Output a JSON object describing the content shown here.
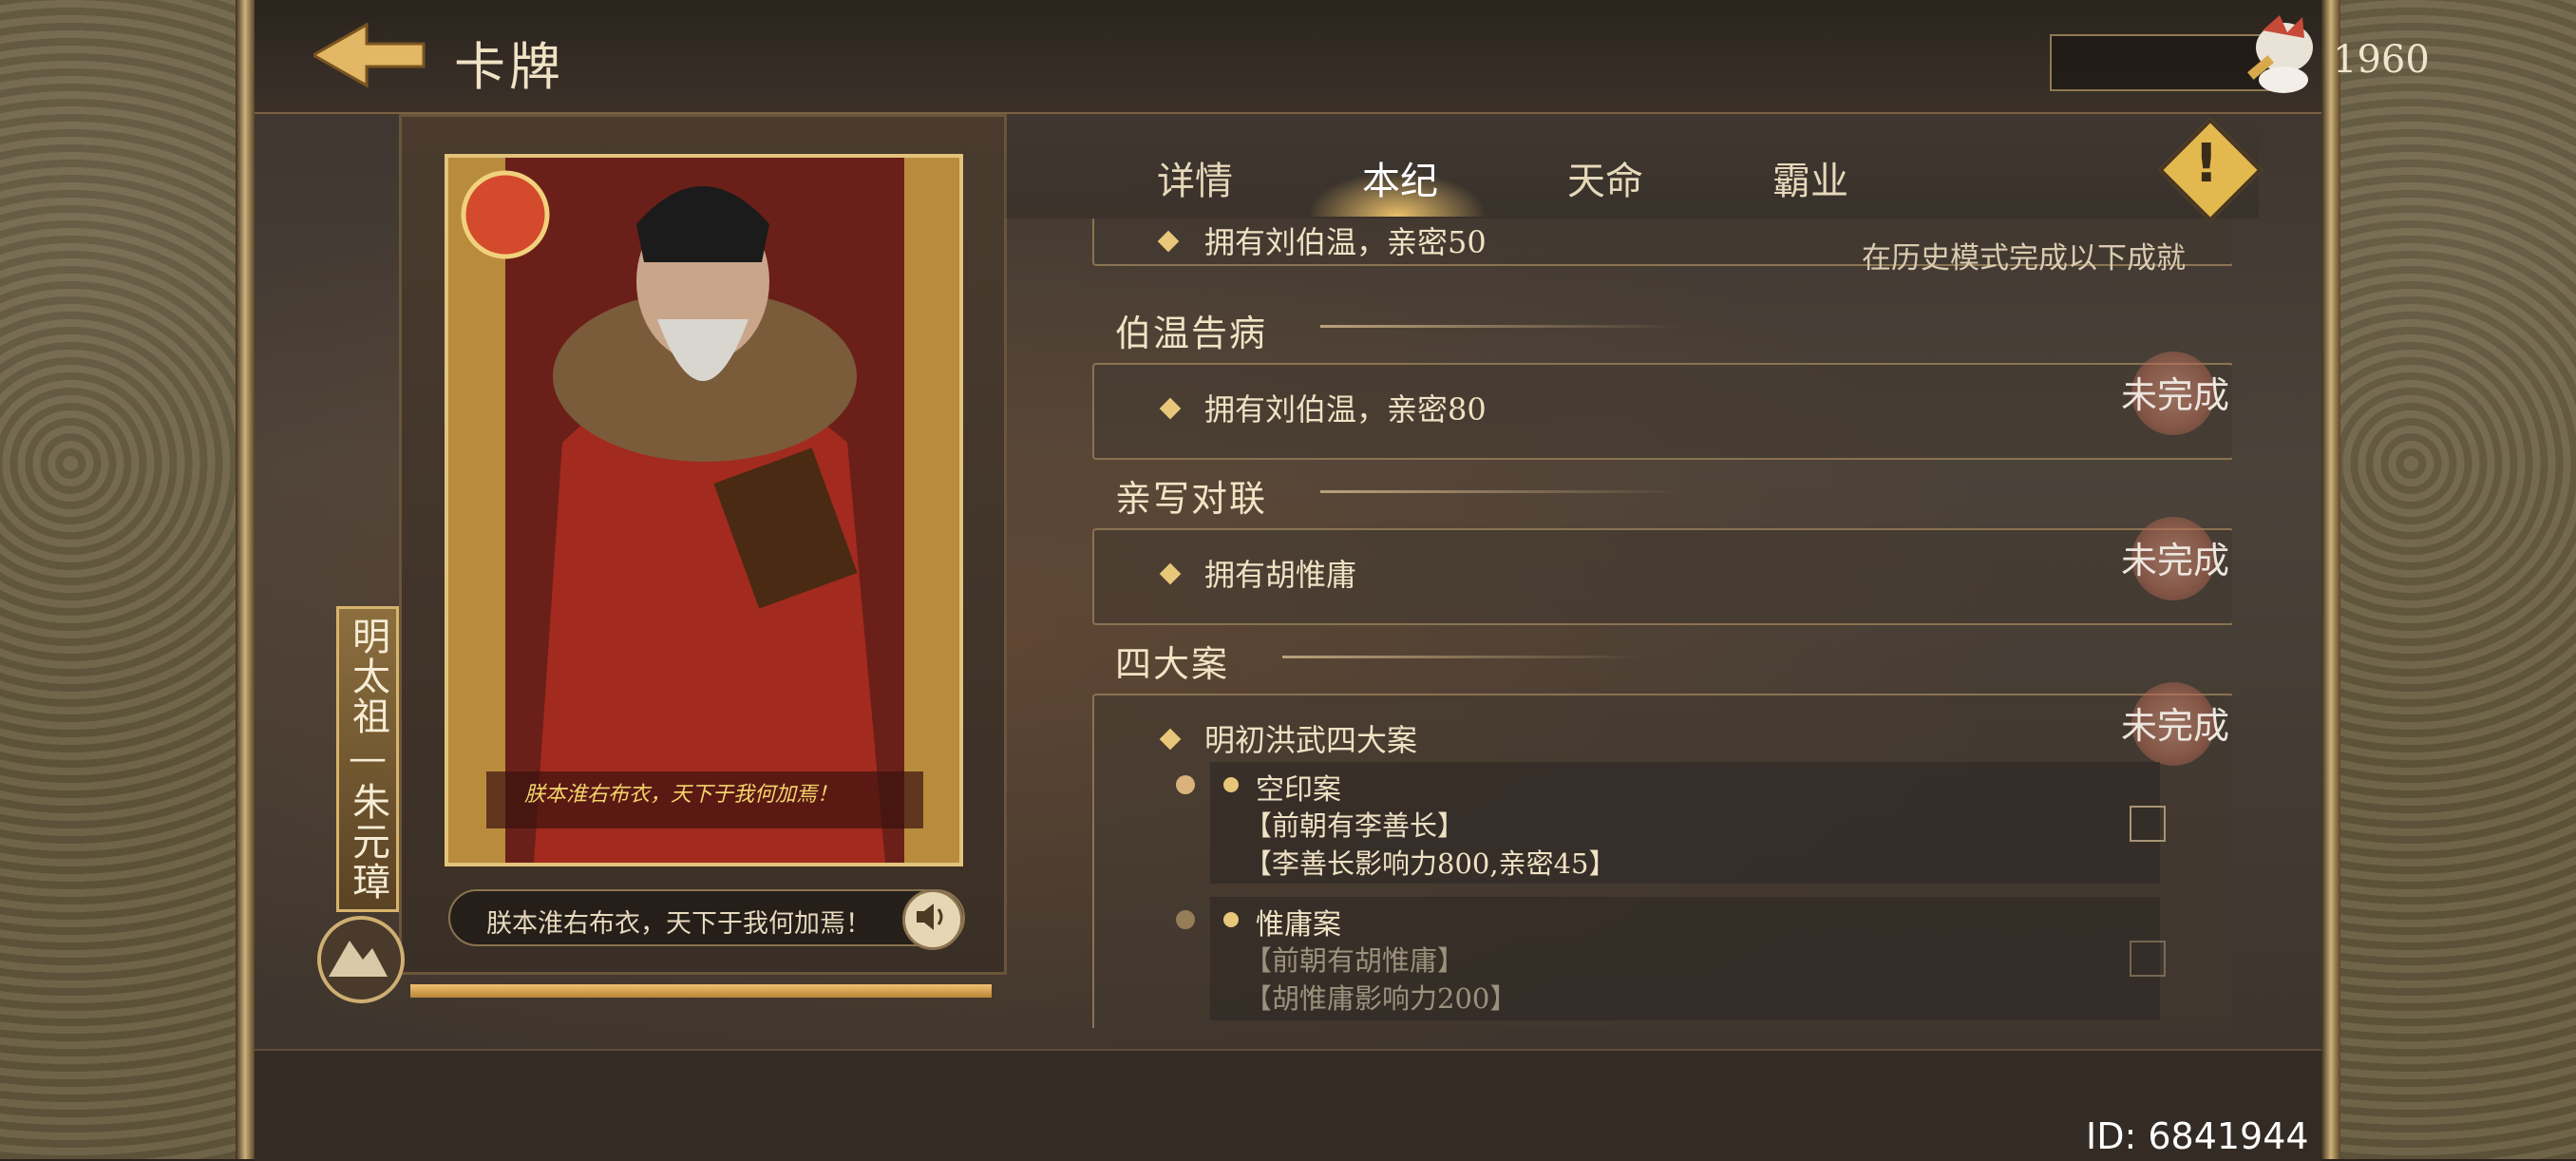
{
  "header": {
    "title": "卡牌",
    "currency_value": "1960"
  },
  "tabs": [
    {
      "label": "详情",
      "active": false
    },
    {
      "label": "本纪",
      "active": true
    },
    {
      "label": "天命",
      "active": false
    },
    {
      "label": "霸业",
      "active": false
    }
  ],
  "card": {
    "vertical_name": "明太祖—朱元璋",
    "quote": "朕本淮右布衣，天下于我何加焉！",
    "art_caption": "朕本淮右布衣，天下于我何加焉！"
  },
  "list": {
    "top_partial": {
      "item": "拥有刘伯温，亲密50",
      "note": "在历史模式完成以下成就"
    },
    "sections": [
      {
        "title": "伯温告病",
        "item": "拥有刘伯温，亲密80",
        "status": "未完成"
      },
      {
        "title": "亲写对联",
        "item": "拥有胡惟庸",
        "status": "未完成"
      },
      {
        "title": "四大案",
        "item": "明初洪武四大案",
        "status": "未完成",
        "subs": [
          {
            "name": "空印案",
            "line1": "【前朝有李善长】",
            "line2": "【李善长影响力800,亲密45】"
          },
          {
            "name": "惟庸案",
            "line1": "【前朝有胡惟庸】",
            "line2": "【胡惟庸影响力200】"
          }
        ]
      }
    ]
  },
  "footer": {
    "user_id": "ID: 6841944"
  },
  "progress": 1.0,
  "colors": {
    "gold": "#e3c37b",
    "tab_glow": "#f4c86e",
    "status_badge": "#2e9f52"
  }
}
